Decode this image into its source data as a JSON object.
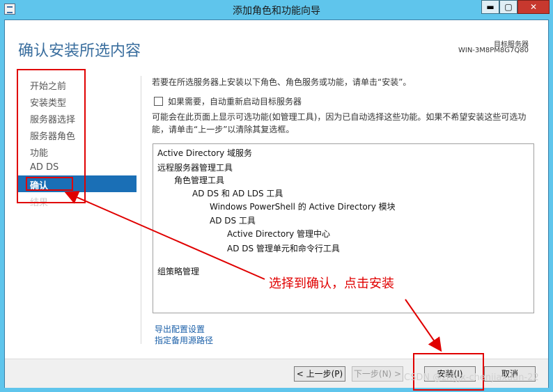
{
  "window": {
    "title": "添加角色和功能向导",
    "controls": {
      "minimize": "▬",
      "maximize": "▢",
      "close": "✕"
    },
    "app_icon": "wizard-window-icon"
  },
  "header": {
    "page_title": "确认安装所选内容",
    "target_label": "目标服务器",
    "target_value": "WIN-3M8PM8G7Q80"
  },
  "nav": {
    "items": [
      "开始之前",
      "安装类型",
      "服务器选择",
      "服务器角色",
      "功能",
      "AD DS"
    ],
    "active": "确认",
    "disabled": "结果"
  },
  "content": {
    "intro": "若要在所选服务器上安装以下角色、角色服务或功能，请单击“安装”。",
    "restart_label": "如果需要，自动重新启动目标服务器",
    "restart_checked": false,
    "note_line1": "可能会在此页面上显示可选功能(如管理工具)，因为已自动选择这些功能。如果不希望安装这些可选功",
    "note_line2": "能，请单击“上一步”以清除其复选框。"
  },
  "selection": {
    "items": [
      "Active Directory 域服务",
      "远程服务器管理工具",
      "角色管理工具",
      "AD DS 和 AD LDS 工具",
      "Windows PowerShell 的 Active Directory 模块",
      "AD DS 工具",
      "Active Directory 管理中心",
      "AD DS 管理单元和命令行工具",
      "组策略管理"
    ]
  },
  "links": {
    "export": "导出配置设置",
    "alternate_source": "指定备用源路径"
  },
  "buttons": {
    "previous": "< 上一步(P)",
    "next": "下一步(N) >",
    "install": "安装(I)",
    "cancel": "取消"
  },
  "annotation": {
    "text": "选择到确认，点击安装",
    "color": "#e00000"
  },
  "watermark": "CSDN @zngjx-chenjiaxuan-22",
  "colors": {
    "title_bar": "#5fc5ec",
    "accent": "#1a6fb6",
    "page_title": "#3a6e9e",
    "link": "#1a5fa8"
  }
}
